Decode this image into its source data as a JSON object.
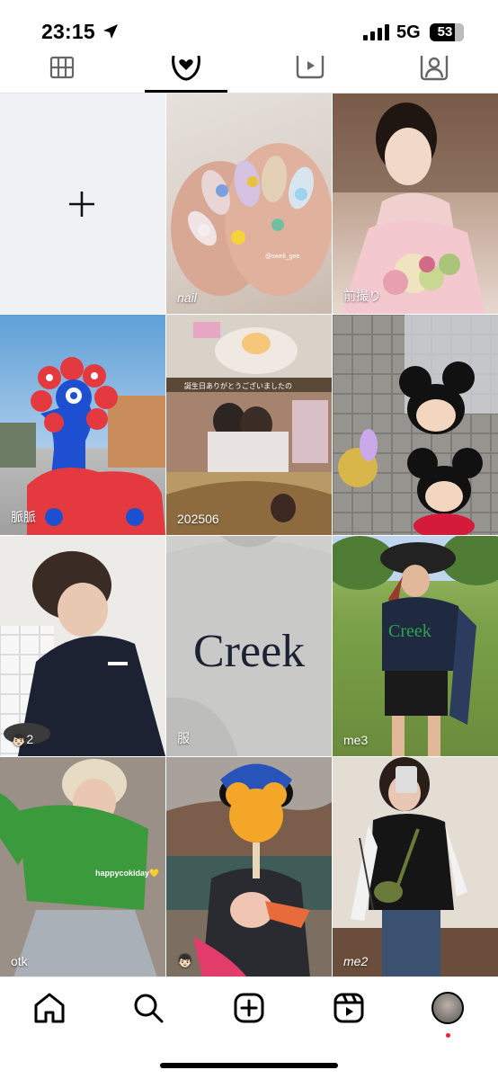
{
  "status_bar": {
    "time": "23:15",
    "network": "5G",
    "battery": "53"
  },
  "profile_tabs": [
    {
      "name": "tab-posts",
      "icon": "grid-icon",
      "active": false
    },
    {
      "name": "tab-saved",
      "icon": "heart-bubble-icon",
      "active": true
    },
    {
      "name": "tab-reels",
      "icon": "reels-icon",
      "active": false
    },
    {
      "name": "tab-tagged",
      "icon": "person-tag-icon",
      "active": false
    }
  ],
  "highlights": [
    {
      "caption": "",
      "is_new": true
    },
    {
      "caption": "nail"
    },
    {
      "caption": "前撮り"
    },
    {
      "caption": "脈脈"
    },
    {
      "caption": "202506"
    },
    {
      "caption": ""
    },
    {
      "caption": "👦🏻2"
    },
    {
      "caption": "服"
    },
    {
      "caption": "me3"
    },
    {
      "caption": "otk"
    },
    {
      "caption": "👦🏻"
    },
    {
      "caption": "me2"
    }
  ],
  "overlay_text": {
    "nail_watermark": "@sweli_gee",
    "sweater_text": "Creek",
    "tshirt_text": "Creek",
    "sticker": "happycokiday💛",
    "story_text": "誕生日ありがとうございましたの"
  },
  "bottom_nav": [
    {
      "name": "nav-home",
      "icon": "home-icon"
    },
    {
      "name": "nav-search",
      "icon": "search-icon"
    },
    {
      "name": "nav-create",
      "icon": "plus-square-icon"
    },
    {
      "name": "nav-reels",
      "icon": "reels-icon"
    },
    {
      "name": "nav-profile",
      "icon": "avatar-icon"
    }
  ],
  "colors": {
    "tab_indicator": "#000000",
    "notification_dot": "#e8213b",
    "empty_tile": "#f0f1f4"
  }
}
